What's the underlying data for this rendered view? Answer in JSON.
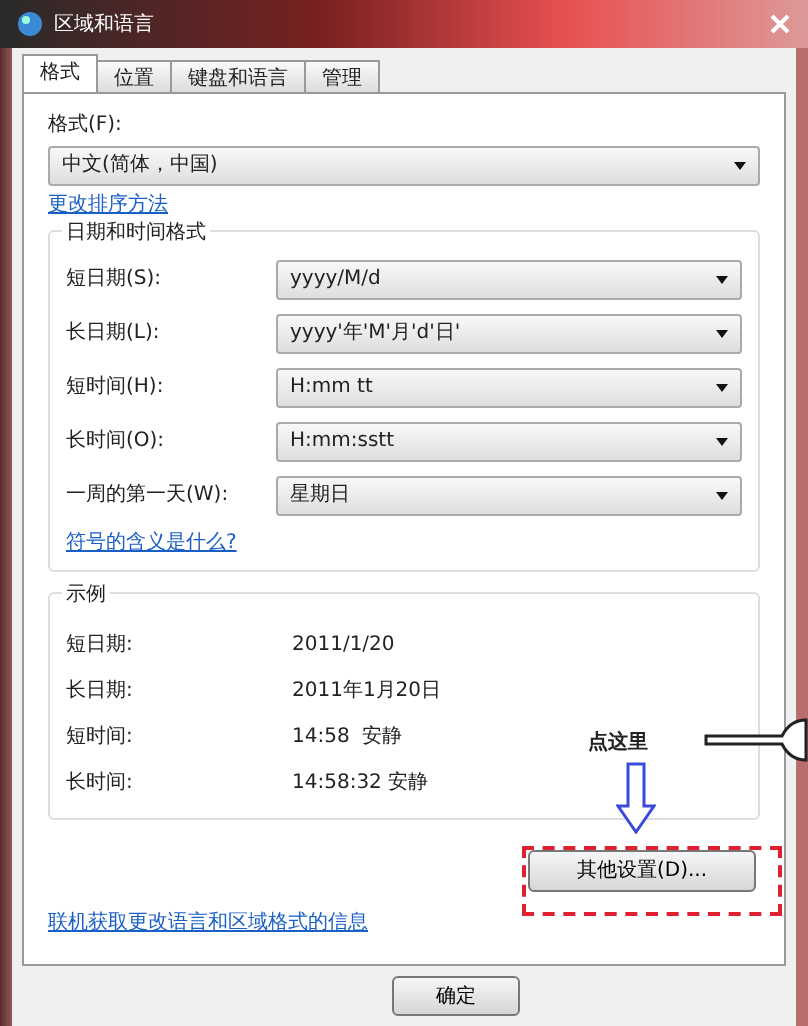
{
  "window": {
    "title": "区域和语言"
  },
  "tabs": [
    {
      "label": "格式",
      "selected": true
    },
    {
      "label": "位置",
      "selected": false
    },
    {
      "label": "键盘和语言",
      "selected": false
    },
    {
      "label": "管理",
      "selected": false
    }
  ],
  "format": {
    "label": "格式(F):",
    "value": "中文(简体，中国)",
    "link": "更改排序方法"
  },
  "datetime_formats": {
    "title": "日期和时间格式",
    "rows": [
      {
        "label": "短日期(S):",
        "value": "yyyy/M/d"
      },
      {
        "label": "长日期(L):",
        "value": "yyyy'年'M'月'd'日'"
      },
      {
        "label": "短时间(H):",
        "value": "H:mm tt"
      },
      {
        "label": "长时间(O):",
        "value": "H:mm:sstt"
      },
      {
        "label": "一周的第一天(W):",
        "value": "星期日"
      }
    ],
    "link": "符号的含义是什么?"
  },
  "examples": {
    "title": "示例",
    "rows": [
      {
        "label": "短日期:",
        "value": "2011/1/20"
      },
      {
        "label": "长日期:",
        "value": "2011年1月20日"
      },
      {
        "label": "短时间:",
        "value": "14:58  安静"
      },
      {
        "label": "长时间:",
        "value": "14:58:32 安静"
      }
    ]
  },
  "annotation": {
    "text": "点这里"
  },
  "other_settings_button": "其他设置(D)...",
  "online_link": "联机获取更改语言和区域格式的信息",
  "buttons": [
    "确定"
  ]
}
